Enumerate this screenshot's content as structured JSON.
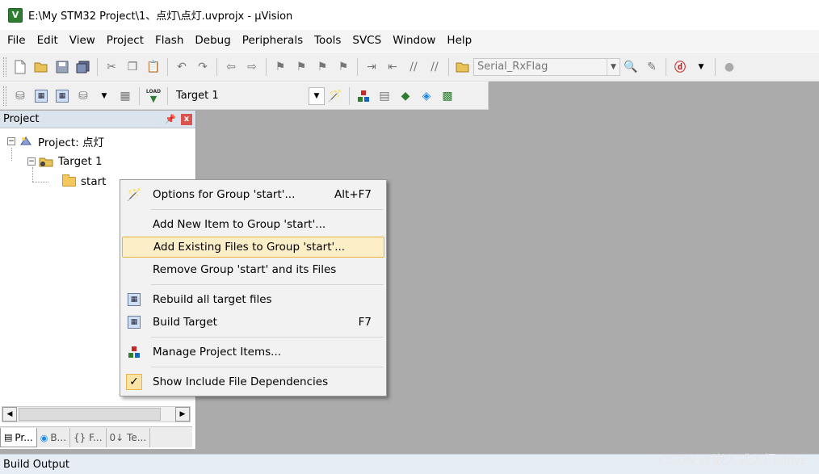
{
  "window": {
    "title": "E:\\My STM32 Project\\1、点灯\\点灯.uvprojx - µVision",
    "app_icon_letter": "V"
  },
  "menu": [
    "File",
    "Edit",
    "View",
    "Project",
    "Flash",
    "Debug",
    "Peripherals",
    "Tools",
    "SVCS",
    "Window",
    "Help"
  ],
  "toolbar1": {
    "find_combo_value": "Serial_RxFlag"
  },
  "toolbar2": {
    "target_name": "Target 1",
    "load_label": "LOAD"
  },
  "project_panel": {
    "title": "Project",
    "pin": "ᵖ",
    "close": "x",
    "tree": {
      "root": "Project: 点灯",
      "target": "Target 1",
      "group": "start"
    },
    "tabs": [
      "Pr...",
      "B...",
      "{} F...",
      "0↓ Te..."
    ]
  },
  "context_menu": {
    "items": [
      {
        "label": "Options for Group 'start'...",
        "shortcut": "Alt+F7",
        "icon": "options-wand-icon"
      },
      {
        "label": "Add New  Item to Group 'start'...",
        "shortcut": "",
        "icon": ""
      },
      {
        "label": "Add Existing Files to Group 'start'...",
        "shortcut": "",
        "icon": "",
        "highlighted": true
      },
      {
        "label": "Remove Group 'start' and its Files",
        "shortcut": "",
        "icon": ""
      },
      {
        "label": "Rebuild all target files",
        "shortcut": "",
        "icon": "rebuild-icon"
      },
      {
        "label": "Build Target",
        "shortcut": "F7",
        "icon": "build-icon"
      },
      {
        "label": "Manage Project Items...",
        "shortcut": "",
        "icon": "manage-items-icon"
      },
      {
        "label": "Show Include File Dependencies",
        "shortcut": "",
        "icon": "checkmark-icon",
        "checked": true
      }
    ]
  },
  "bottom": {
    "build_output": "Build Output",
    "watermark": "CSDN @嵌入式入门strive"
  },
  "colors": {
    "workspace": "#ababab",
    "highlight_bg": "#fcefc8",
    "highlight_border": "#e9b23e",
    "panel_header": "#dbe3ec"
  }
}
